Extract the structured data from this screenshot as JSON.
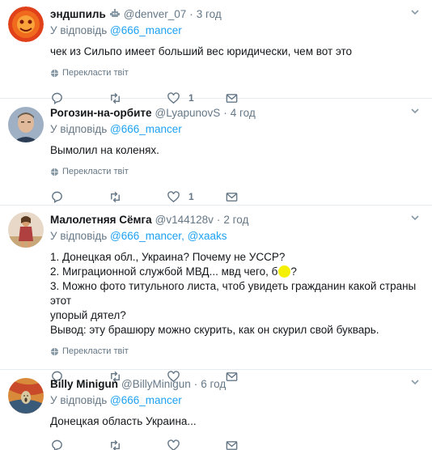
{
  "reply_prefix": "У відповідь",
  "translate_label": "Перекласти твіт",
  "tweets": [
    {
      "name": "эндшпиль",
      "handle": "@denver_07",
      "time": "3 год",
      "reply_to": [
        "@666_mancer"
      ],
      "text_lines": [
        "чек из Сильпо имеет больший вес юридически, чем вот это"
      ],
      "likes": "1"
    },
    {
      "name": "Рогозин-на-орбите",
      "handle": "@LyapunovS",
      "time": "4 год",
      "reply_to": [
        "@666_mancer"
      ],
      "text_lines": [
        "Вымолил на коленях."
      ],
      "likes": "1"
    },
    {
      "name": "Малолетняя Сёмга",
      "handle": "@v144128v",
      "time": "2 год",
      "reply_to": [
        "@666_mancer",
        "@xaaks"
      ],
      "text_lines": [
        "1. Донецкая обл., Украина? Почему не УССР?",
        "2. Миграционной службой МВД... мвд чего, б",
        "?",
        "3. Можно фото титульного листа, чтоб увидеть гражданин какой страны этот",
        "упорый дятел?",
        "Вывод: эту брашюру можно скурить, как он скурил свой букварь."
      ],
      "likes": ""
    },
    {
      "name": "Billy Minigun",
      "handle": "@BillyMinigun",
      "time": "6 год",
      "reply_to": [
        "@666_mancer"
      ],
      "text_lines": [
        "Донецкая область Украина..."
      ],
      "likes": ""
    }
  ],
  "colors": {
    "link": "#1da1f2",
    "muted": "#657786",
    "divider": "#e6ecf0",
    "highlight": "#f5f000"
  }
}
